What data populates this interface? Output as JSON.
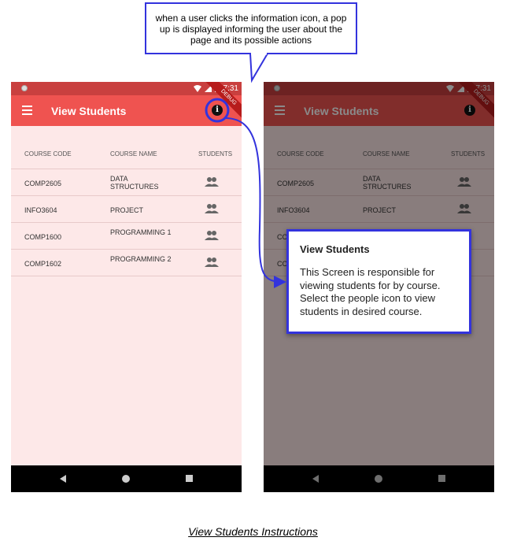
{
  "callout": {
    "text": "when a user clicks the information icon, a pop up is displayed informing the user about the page and its possible actions"
  },
  "screen": {
    "time": "7:31",
    "title": "View Students",
    "debug_label": "DEBUG",
    "columns": {
      "code": "COURSE CODE",
      "name": "COURSE NAME",
      "students": "STUDENTS"
    },
    "rows": [
      {
        "code": "COMP2605",
        "name": "DATA STRUCTURES"
      },
      {
        "code": "INFO3604",
        "name": "PROJECT"
      },
      {
        "code": "COMP1600",
        "name": "PROGRAMMING 1"
      },
      {
        "code": "COMP1602",
        "name": "PROGRAMMING 2"
      }
    ]
  },
  "dialog": {
    "title": "View Students",
    "body": "This Screen is responsible for viewing students for by course. Select the people icon to view students in desired course."
  },
  "caption": "View Students Instructions",
  "colors": {
    "appbar": "#ef5350",
    "status": "#c9403f",
    "highlight": "#3333dd",
    "background": "#fde8e8"
  },
  "icons": {
    "menu": "menu-icon",
    "info": "info-icon",
    "people": "people-icon"
  }
}
